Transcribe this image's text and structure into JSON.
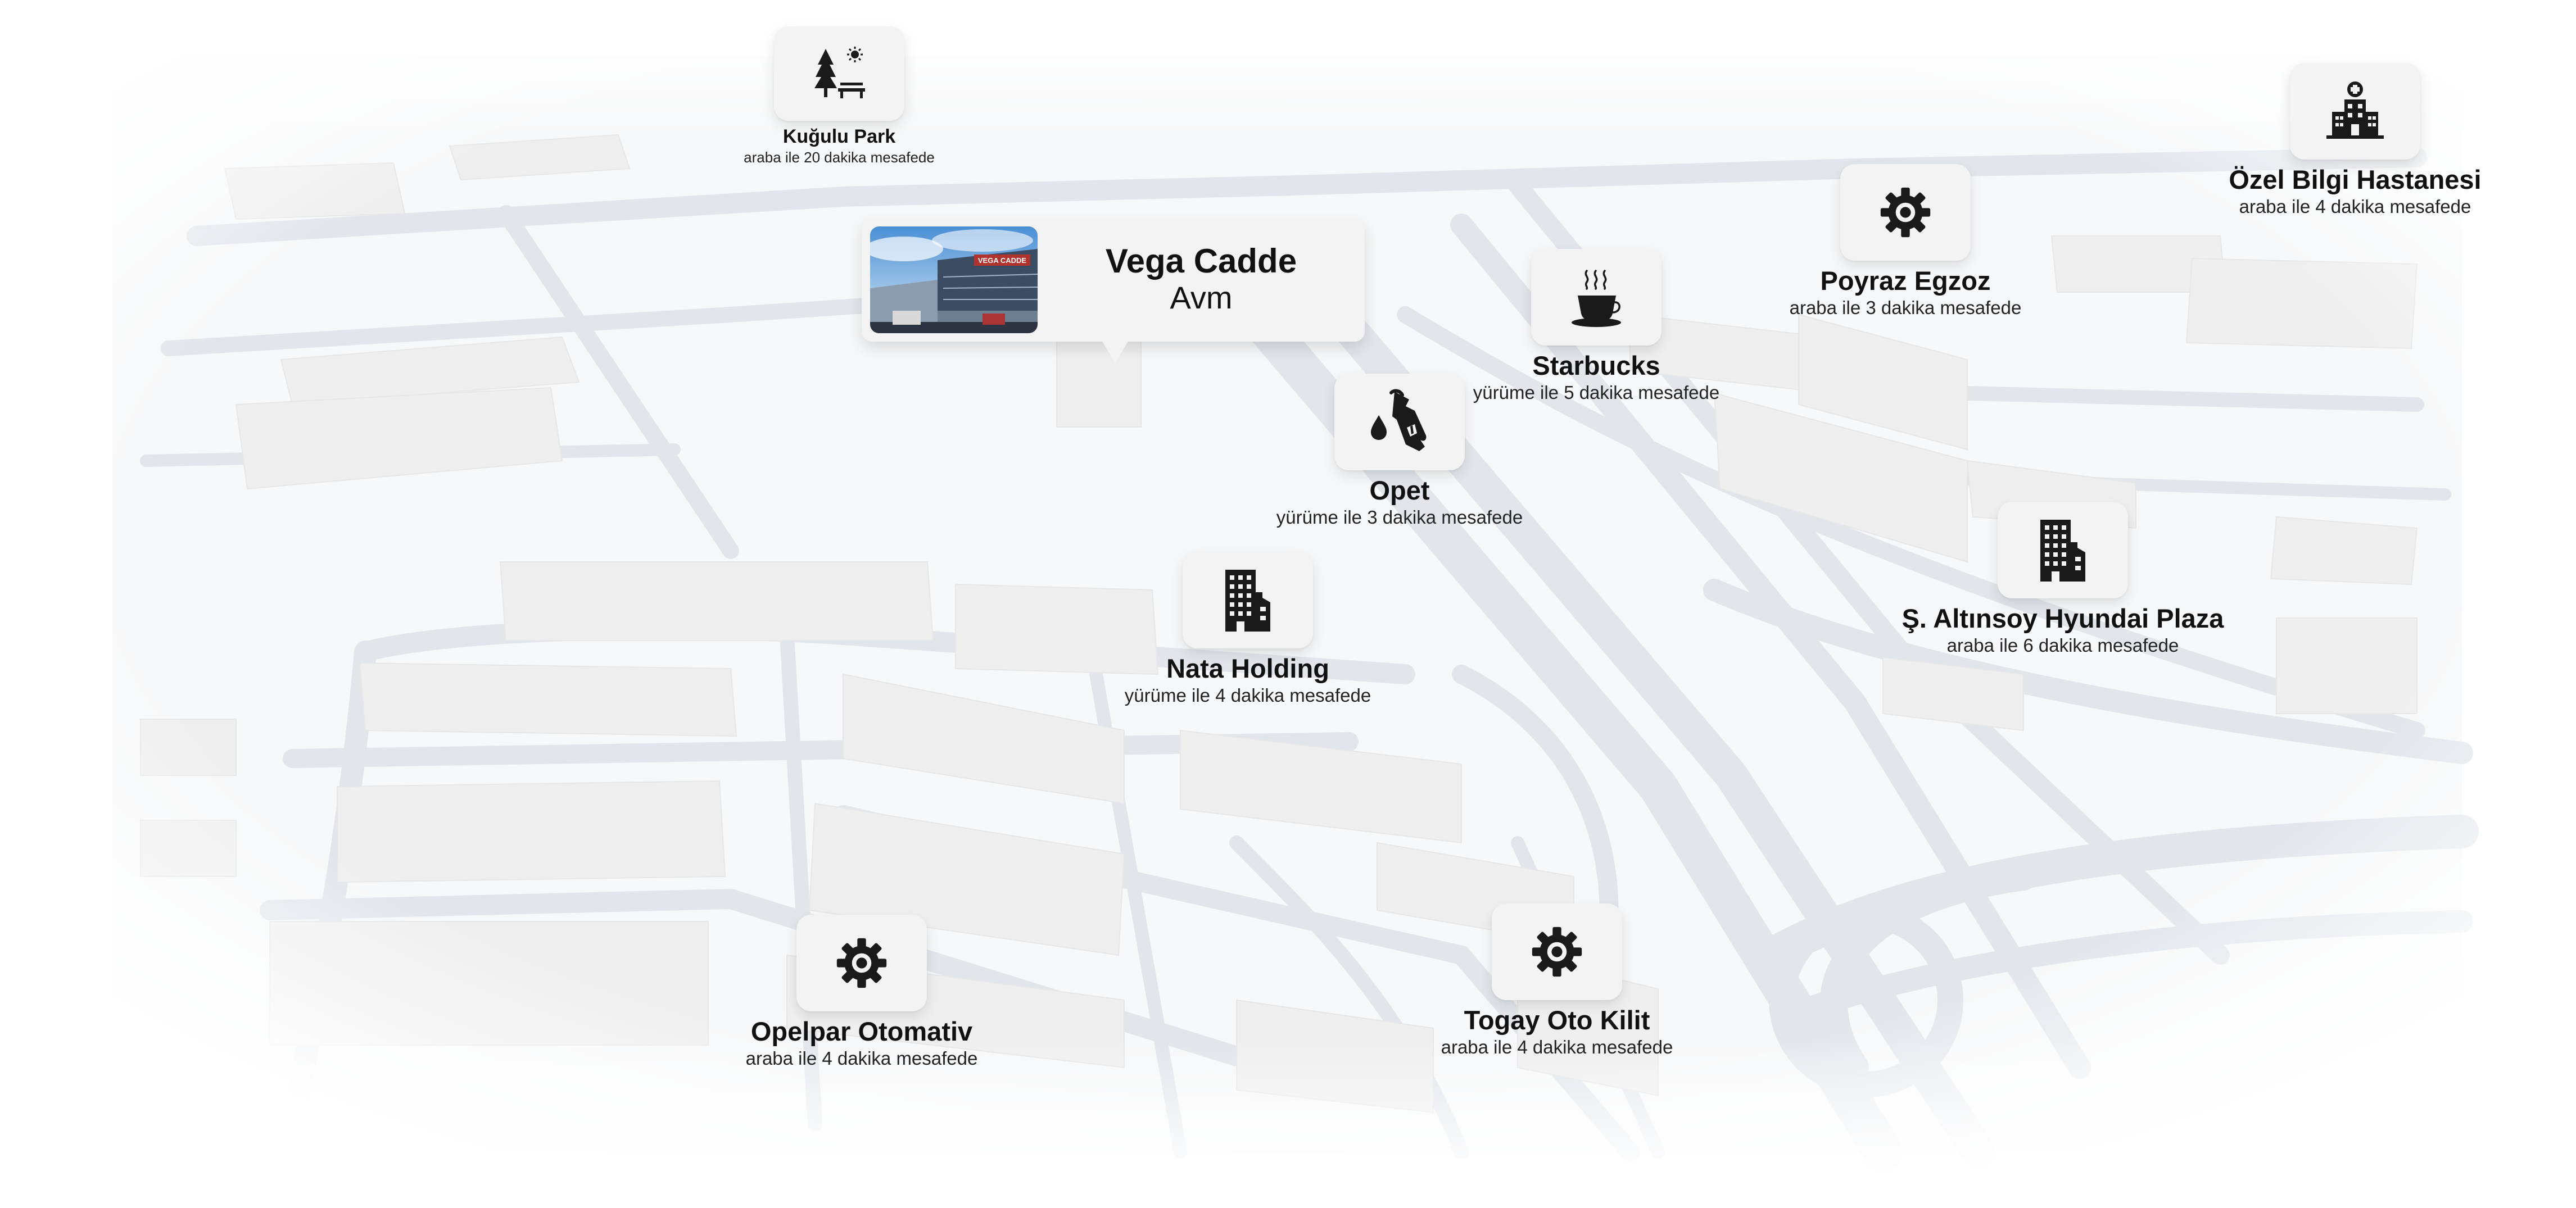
{
  "featured": {
    "title": "Vega Cadde",
    "subtitle": "Avm",
    "photo_sign": "VEGA CADDE"
  },
  "pois": {
    "kugulu_park": {
      "name": "Kuğulu Park",
      "distance": "araba ile 20 dakika mesafede",
      "icon": "park-icon"
    },
    "ozel_bilgi": {
      "name": "Özel Bilgi Hastanesi",
      "distance": "araba ile 4 dakika mesafede",
      "icon": "hospital-icon"
    },
    "poyraz": {
      "name": "Poyraz Egzoz",
      "distance": "araba ile 3 dakika mesafede",
      "icon": "gear-icon"
    },
    "starbucks": {
      "name": "Starbucks",
      "distance": "yürüme ile 5 dakika mesafede",
      "icon": "coffee-cup-icon"
    },
    "opet": {
      "name": "Opet",
      "distance": "yürüme ile 3 dakika mesafede",
      "icon": "fuel-nozzle-icon"
    },
    "nata": {
      "name": "Nata Holding",
      "distance": "yürüme ile 4 dakika mesafede",
      "icon": "office-building-icon"
    },
    "altinsoy": {
      "name": "Ş. Altınsoy Hyundai Plaza",
      "distance": "araba ile 6 dakika mesafede",
      "icon": "office-building-icon"
    },
    "opelpar": {
      "name": "Opelpar Otomativ",
      "distance": "araba ile 4 dakika mesafede",
      "icon": "gear-icon"
    },
    "togay": {
      "name": "Togay Oto Kilit",
      "distance": "araba ile 4 dakika mesafede",
      "icon": "gear-icon"
    }
  },
  "colors": {
    "tile": "#f3f3f3",
    "icon": "#1a1a1a",
    "road": "#e3e7ec",
    "building": "#f0f0f0"
  }
}
